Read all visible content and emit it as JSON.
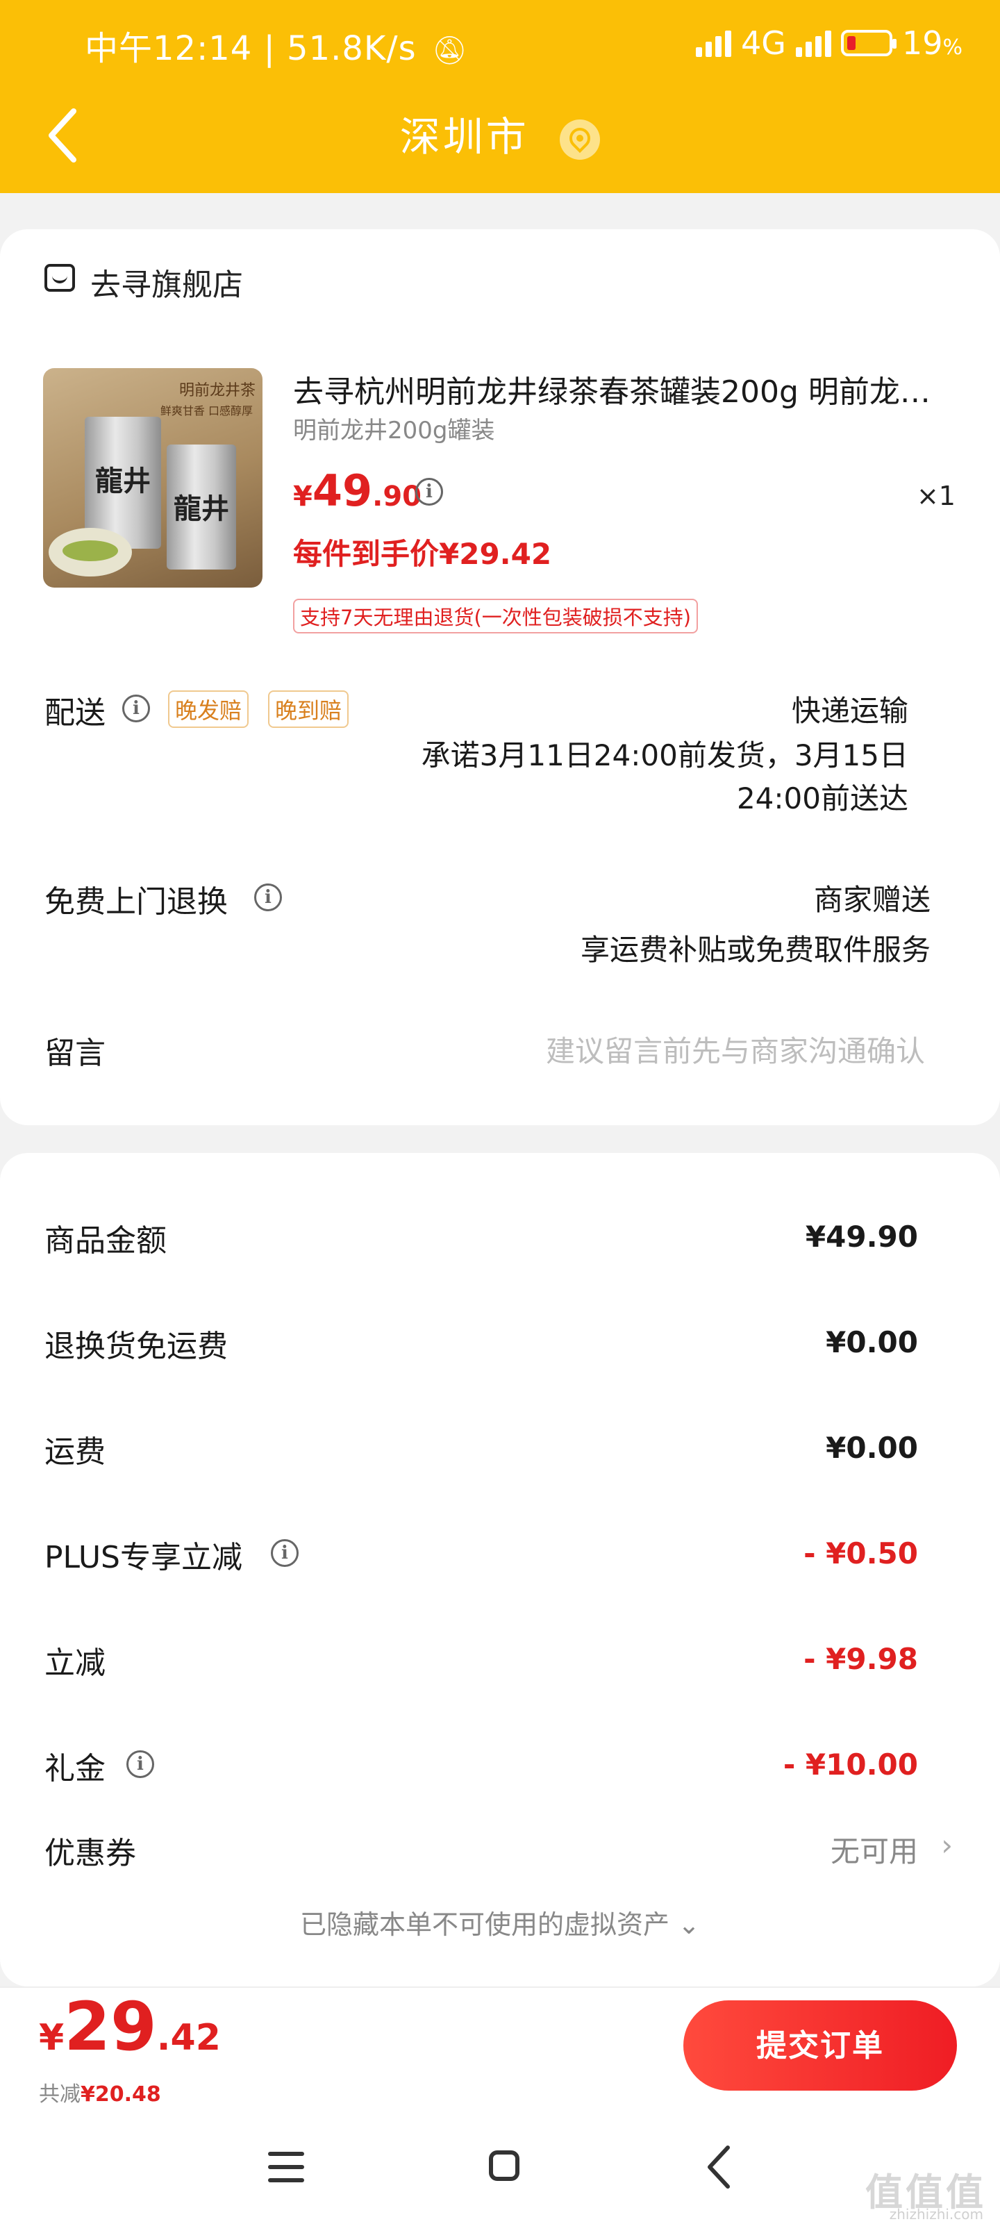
{
  "status_bar": {
    "time": "中午12:14",
    "speed": "51.8K/s",
    "network": "4G",
    "battery": "19",
    "battery_unit": "%"
  },
  "header": {
    "title": "深圳市"
  },
  "shop": {
    "name": "去寻旗舰店"
  },
  "product": {
    "title": "去寻杭州明前龙井绿茶春茶罐装200g 明前龙…",
    "spec": "明前龙井200g罐装",
    "price_symbol": "¥",
    "price_int": "49",
    "price_dec": ".90",
    "quantity": "×1",
    "net_price": "每件到手价¥29.42",
    "return_policy": "支持7天无理由退货(一次性包装破损不支持)",
    "image_text": {
      "tag": "明前龙井茶",
      "tag2": "鲜爽甘香 口感醇厚",
      "can": "龍井"
    }
  },
  "delivery": {
    "label": "配送",
    "badges": [
      "晚发赔",
      "晚到赔"
    ],
    "method": "快递运输",
    "promise_line1": "承诺3月11日24:00前发货，3月15日",
    "promise_line2": "24:00前送达"
  },
  "exchange": {
    "label": "免费上门退换",
    "value": "商家赠送",
    "desc": "享运费补贴或免费取件服务"
  },
  "message": {
    "label": "留言",
    "placeholder": "建议留言前先与商家沟通确认"
  },
  "fees": [
    {
      "label": "商品金额",
      "value": "¥49.90"
    },
    {
      "label": "退换货免运费",
      "value": "¥0.00"
    },
    {
      "label": "运费",
      "value": "¥0.00"
    },
    {
      "label": "PLUS专享立减",
      "value": "- ¥0.50"
    },
    {
      "label": "立减",
      "value": "- ¥9.98"
    },
    {
      "label": "礼金",
      "value": "- ¥10.00"
    }
  ],
  "coupon": {
    "label": "优惠券",
    "value": "无可用"
  },
  "hidden_assets": "已隐藏本单不可使用的虚拟资产",
  "footer": {
    "total_symbol": "¥",
    "total_int": "29",
    "total_dec": ".42",
    "saving_label": "共减",
    "saving_value": "¥20.48",
    "submit_label": "提交订单"
  },
  "watermark": {
    "text": "值值值",
    "sub": "zhizhizhi.com"
  },
  "colors": {
    "header": "#fbbf06",
    "accent": "#e02020",
    "badge": "#d9801e"
  }
}
